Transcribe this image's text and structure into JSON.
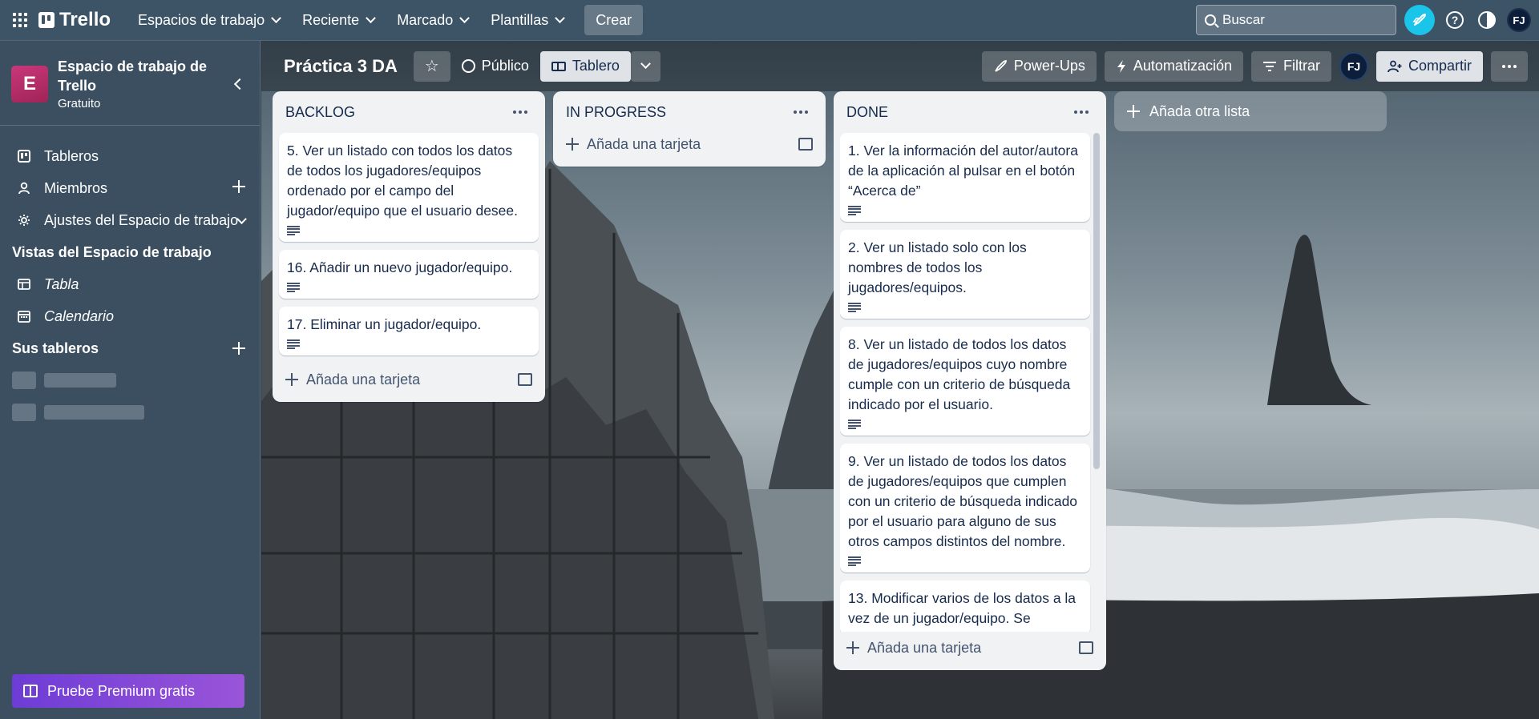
{
  "topbar": {
    "logo": "Trello",
    "menu": [
      {
        "label": "Espacios de trabajo"
      },
      {
        "label": "Reciente"
      },
      {
        "label": "Marcado"
      },
      {
        "label": "Plantillas"
      }
    ],
    "create_label": "Crear",
    "search_placeholder": "Buscar",
    "avatar_initials": "FJ"
  },
  "sidebar": {
    "workspace_initial": "E",
    "workspace_name": "Espacio de trabajo de Trello",
    "workspace_plan": "Gratuito",
    "items": [
      {
        "label": "Tableros",
        "icon": "board-icon"
      },
      {
        "label": "Miembros",
        "icon": "person-icon"
      },
      {
        "label": "Ajustes del Espacio de trabajo",
        "icon": "gear-icon"
      }
    ],
    "views_heading": "Vistas del Espacio de trabajo",
    "views": [
      {
        "label": "Tabla",
        "icon": "table-icon"
      },
      {
        "label": "Calendario",
        "icon": "calendar-icon"
      }
    ],
    "boards_heading": "Sus tableros",
    "premium_label": "Pruebe Premium gratis"
  },
  "board": {
    "title": "Práctica 3 DA",
    "visibility_label": "Público",
    "view_label": "Tablero",
    "powerups_label": "Power-Ups",
    "automation_label": "Automatización",
    "filter_label": "Filtrar",
    "member_initials": "FJ",
    "share_label": "Compartir",
    "add_list_label": "Añada otra lista",
    "lists": [
      {
        "title": "BACKLOG",
        "cards": [
          "5. Ver un listado con todos los datos de todos los jugadores/equipos ordenado por el campo del jugador/equipo que el usuario desee.",
          "16. Añadir un nuevo jugador/equipo.",
          "17. Eliminar un jugador/equipo."
        ],
        "add_card_label": "Añada una tarjeta"
      },
      {
        "title": "IN PROGRESS",
        "cards": [],
        "add_card_label": "Añada una tarjeta"
      },
      {
        "title": "DONE",
        "cards": [
          "1. Ver la información del autor/autora de la aplicación al pulsar en el botón “Acerca de”",
          "2. Ver un listado solo con los nombres de todos los jugadores/equipos.",
          "8. Ver un listado de todos los datos de jugadores/equipos cuyo nombre cumple con un criterio de búsqueda indicado por el usuario.",
          "9. Ver un listado de todos los datos de jugadores/equipos que cumplen con un criterio de búsqueda indicado por el usuario para alguno de sus otros campos distintos del nombre.",
          "13. Modificar varios de los datos a la vez de un jugador/equipo. Se"
        ],
        "add_card_label": "Añada una tarjeta"
      }
    ]
  },
  "colors": {
    "topbar": "#3d5366",
    "sidebar": "#3b4f61",
    "list_bg": "#f1f2f4",
    "accent_cyan": "#1bc5ea",
    "workspace_badge": "#c9377a",
    "premium": "#7b45d8"
  }
}
